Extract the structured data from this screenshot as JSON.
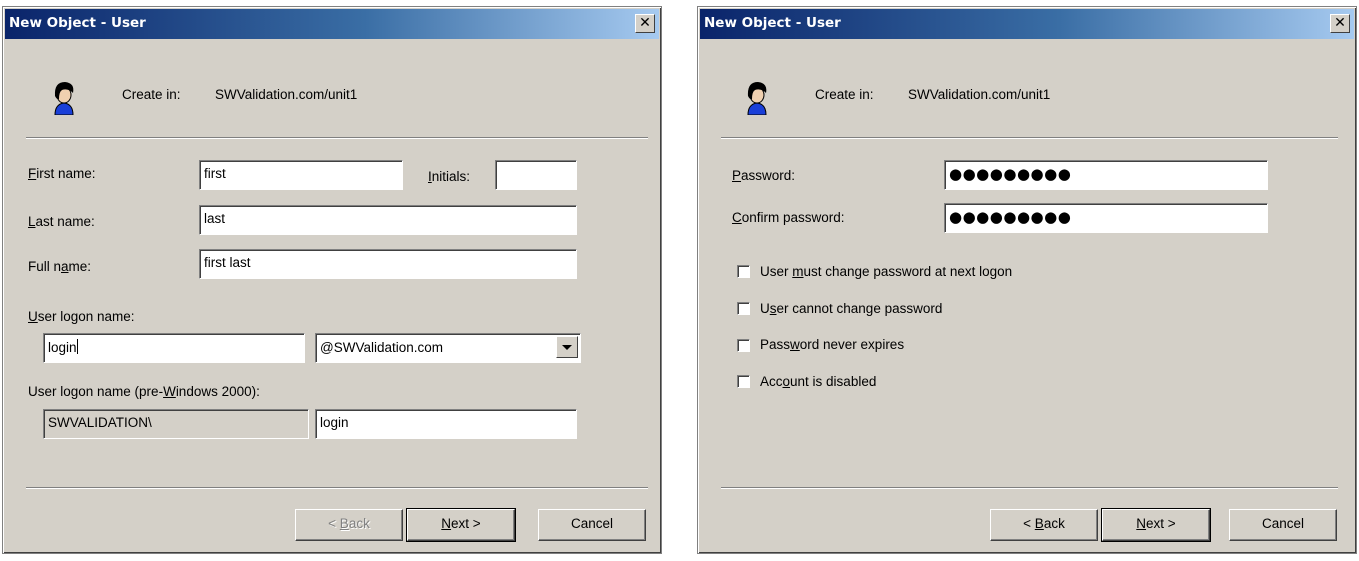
{
  "colors": {
    "titlebar_start": "#0a246a",
    "titlebar_end": "#a6caf0",
    "dialog_bg": "#d4d0c8"
  },
  "dialog1": {
    "title": "New Object - User",
    "close_icon": "close-icon",
    "create_in_label": "Create in:",
    "create_in_value": "SWValidation.com/unit1",
    "first_name": {
      "pre": "",
      "key": "F",
      "post": "irst name:",
      "value": "first"
    },
    "initials": {
      "pre": "",
      "key": "I",
      "post": "nitials:",
      "value": ""
    },
    "last_name": {
      "pre": "",
      "key": "L",
      "post": "ast name:",
      "value": "last"
    },
    "full_name": {
      "pre": "Full n",
      "key": "a",
      "post": "me:",
      "value": "first last"
    },
    "logon_name": {
      "pre": "",
      "key": "U",
      "post": "ser logon name:",
      "value": "login"
    },
    "domain_select": {
      "value": "@SWValidation.com"
    },
    "pre_win2000": {
      "pre": "User logon name (pre-",
      "key": "W",
      "post": "indows 2000):",
      "domain_value": "SWVALIDATION\\",
      "value": "login"
    },
    "buttons": {
      "back": {
        "pre": "< ",
        "key": "B",
        "post": "ack"
      },
      "next": {
        "pre": "",
        "key": "N",
        "post": "ext >"
      },
      "cancel": "Cancel"
    }
  },
  "dialog2": {
    "title": "New Object - User",
    "close_icon": "close-icon",
    "create_in_label": "Create in:",
    "create_in_value": "SWValidation.com/unit1",
    "password": {
      "pre": "",
      "key": "P",
      "post": "assword:",
      "value": "●●●●●●●●●"
    },
    "confirm_password": {
      "pre": "",
      "key": "C",
      "post": "onfirm password:",
      "value": "●●●●●●●●●"
    },
    "checkboxes": [
      {
        "pre": "User ",
        "key": "m",
        "post": "ust change password at next logon",
        "checked": false
      },
      {
        "pre": "U",
        "key": "s",
        "post": "er cannot change password",
        "checked": false
      },
      {
        "pre": "Pass",
        "key": "w",
        "post": "ord never expires",
        "checked": false
      },
      {
        "pre": "Acc",
        "key": "o",
        "post": "unt is disabled",
        "checked": false
      }
    ],
    "buttons": {
      "back": {
        "pre": "< ",
        "key": "B",
        "post": "ack"
      },
      "next": {
        "pre": "",
        "key": "N",
        "post": "ext >"
      },
      "cancel": "Cancel"
    }
  }
}
